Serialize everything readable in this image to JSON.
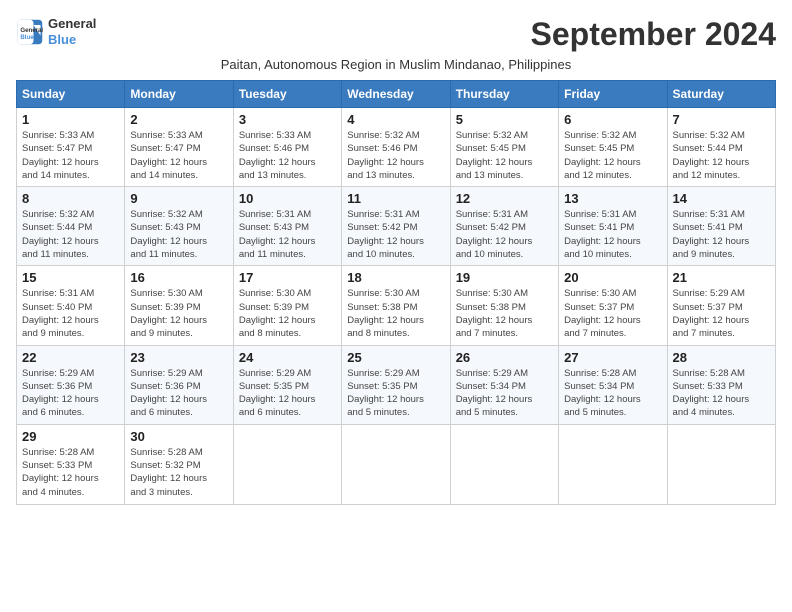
{
  "header": {
    "logo_line1": "General",
    "logo_line2": "Blue",
    "month": "September 2024",
    "subtitle": "Paitan, Autonomous Region in Muslim Mindanao, Philippines"
  },
  "weekdays": [
    "Sunday",
    "Monday",
    "Tuesday",
    "Wednesday",
    "Thursday",
    "Friday",
    "Saturday"
  ],
  "weeks": [
    [
      {
        "day": "1",
        "info": "Sunrise: 5:33 AM\nSunset: 5:47 PM\nDaylight: 12 hours\nand 14 minutes."
      },
      {
        "day": "2",
        "info": "Sunrise: 5:33 AM\nSunset: 5:47 PM\nDaylight: 12 hours\nand 14 minutes."
      },
      {
        "day": "3",
        "info": "Sunrise: 5:33 AM\nSunset: 5:46 PM\nDaylight: 12 hours\nand 13 minutes."
      },
      {
        "day": "4",
        "info": "Sunrise: 5:32 AM\nSunset: 5:46 PM\nDaylight: 12 hours\nand 13 minutes."
      },
      {
        "day": "5",
        "info": "Sunrise: 5:32 AM\nSunset: 5:45 PM\nDaylight: 12 hours\nand 13 minutes."
      },
      {
        "day": "6",
        "info": "Sunrise: 5:32 AM\nSunset: 5:45 PM\nDaylight: 12 hours\nand 12 minutes."
      },
      {
        "day": "7",
        "info": "Sunrise: 5:32 AM\nSunset: 5:44 PM\nDaylight: 12 hours\nand 12 minutes."
      }
    ],
    [
      {
        "day": "8",
        "info": "Sunrise: 5:32 AM\nSunset: 5:44 PM\nDaylight: 12 hours\nand 11 minutes."
      },
      {
        "day": "9",
        "info": "Sunrise: 5:32 AM\nSunset: 5:43 PM\nDaylight: 12 hours\nand 11 minutes."
      },
      {
        "day": "10",
        "info": "Sunrise: 5:31 AM\nSunset: 5:43 PM\nDaylight: 12 hours\nand 11 minutes."
      },
      {
        "day": "11",
        "info": "Sunrise: 5:31 AM\nSunset: 5:42 PM\nDaylight: 12 hours\nand 10 minutes."
      },
      {
        "day": "12",
        "info": "Sunrise: 5:31 AM\nSunset: 5:42 PM\nDaylight: 12 hours\nand 10 minutes."
      },
      {
        "day": "13",
        "info": "Sunrise: 5:31 AM\nSunset: 5:41 PM\nDaylight: 12 hours\nand 10 minutes."
      },
      {
        "day": "14",
        "info": "Sunrise: 5:31 AM\nSunset: 5:41 PM\nDaylight: 12 hours\nand 9 minutes."
      }
    ],
    [
      {
        "day": "15",
        "info": "Sunrise: 5:31 AM\nSunset: 5:40 PM\nDaylight: 12 hours\nand 9 minutes."
      },
      {
        "day": "16",
        "info": "Sunrise: 5:30 AM\nSunset: 5:39 PM\nDaylight: 12 hours\nand 9 minutes."
      },
      {
        "day": "17",
        "info": "Sunrise: 5:30 AM\nSunset: 5:39 PM\nDaylight: 12 hours\nand 8 minutes."
      },
      {
        "day": "18",
        "info": "Sunrise: 5:30 AM\nSunset: 5:38 PM\nDaylight: 12 hours\nand 8 minutes."
      },
      {
        "day": "19",
        "info": "Sunrise: 5:30 AM\nSunset: 5:38 PM\nDaylight: 12 hours\nand 7 minutes."
      },
      {
        "day": "20",
        "info": "Sunrise: 5:30 AM\nSunset: 5:37 PM\nDaylight: 12 hours\nand 7 minutes."
      },
      {
        "day": "21",
        "info": "Sunrise: 5:29 AM\nSunset: 5:37 PM\nDaylight: 12 hours\nand 7 minutes."
      }
    ],
    [
      {
        "day": "22",
        "info": "Sunrise: 5:29 AM\nSunset: 5:36 PM\nDaylight: 12 hours\nand 6 minutes."
      },
      {
        "day": "23",
        "info": "Sunrise: 5:29 AM\nSunset: 5:36 PM\nDaylight: 12 hours\nand 6 minutes."
      },
      {
        "day": "24",
        "info": "Sunrise: 5:29 AM\nSunset: 5:35 PM\nDaylight: 12 hours\nand 6 minutes."
      },
      {
        "day": "25",
        "info": "Sunrise: 5:29 AM\nSunset: 5:35 PM\nDaylight: 12 hours\nand 5 minutes."
      },
      {
        "day": "26",
        "info": "Sunrise: 5:29 AM\nSunset: 5:34 PM\nDaylight: 12 hours\nand 5 minutes."
      },
      {
        "day": "27",
        "info": "Sunrise: 5:28 AM\nSunset: 5:34 PM\nDaylight: 12 hours\nand 5 minutes."
      },
      {
        "day": "28",
        "info": "Sunrise: 5:28 AM\nSunset: 5:33 PM\nDaylight: 12 hours\nand 4 minutes."
      }
    ],
    [
      {
        "day": "29",
        "info": "Sunrise: 5:28 AM\nSunset: 5:33 PM\nDaylight: 12 hours\nand 4 minutes."
      },
      {
        "day": "30",
        "info": "Sunrise: 5:28 AM\nSunset: 5:32 PM\nDaylight: 12 hours\nand 3 minutes."
      },
      {
        "day": "",
        "info": ""
      },
      {
        "day": "",
        "info": ""
      },
      {
        "day": "",
        "info": ""
      },
      {
        "day": "",
        "info": ""
      },
      {
        "day": "",
        "info": ""
      }
    ]
  ]
}
